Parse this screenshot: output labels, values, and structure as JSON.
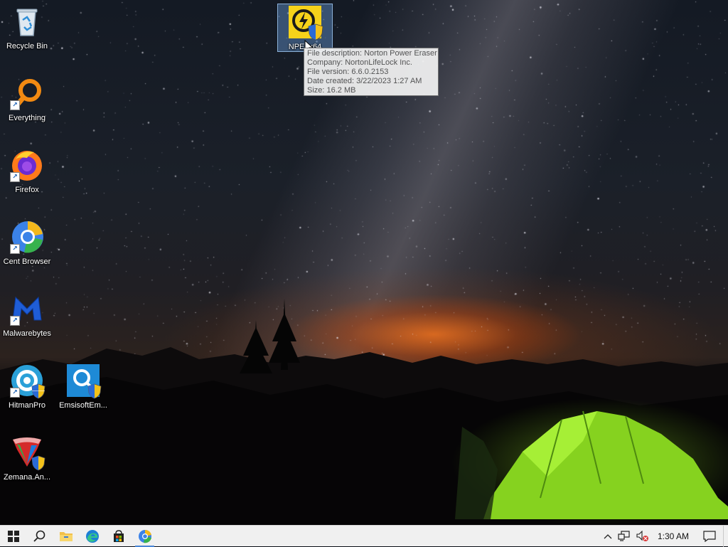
{
  "desktop": {
    "icons": [
      {
        "label": "Recycle Bin",
        "icon": "recycle-bin-icon"
      },
      {
        "label": "Everything",
        "icon": "everything-search-icon"
      },
      {
        "label": "Firefox",
        "icon": "firefox-icon"
      },
      {
        "label": "Cent Browser",
        "icon": "cent-browser-icon"
      },
      {
        "label": "Malwarebytes",
        "icon": "malwarebytes-icon"
      },
      {
        "label": "HitmanPro",
        "icon": "hitmanpro-icon"
      },
      {
        "label": "EmsisoftEm...",
        "icon": "emsisoft-icon"
      },
      {
        "label": "Zemana.An...",
        "icon": "zemana-icon"
      },
      {
        "label": "NPE_x64",
        "icon": "norton-power-eraser-icon"
      }
    ],
    "tooltip": {
      "lines": [
        "File description: Norton Power Eraser",
        "Company: NortonLifeLock Inc.",
        "File version: 6.6.0.2153",
        "Date created: 3/22/2023 1:27 AM",
        "Size: 16.2 MB"
      ]
    }
  },
  "taskbar": {
    "buttons": [
      "start-icon",
      "search-icon",
      "file-explorer-icon",
      "edge-icon",
      "store-icon",
      "cent-browser-icon"
    ],
    "tray": {
      "clock": "1:30 AM",
      "icons": [
        "chevron-up-icon",
        "network-icon",
        "volume-muted-icon",
        "notification-icon"
      ]
    },
    "colors": {
      "accent": "#4a86d6",
      "background": "#f0f0f0"
    }
  }
}
